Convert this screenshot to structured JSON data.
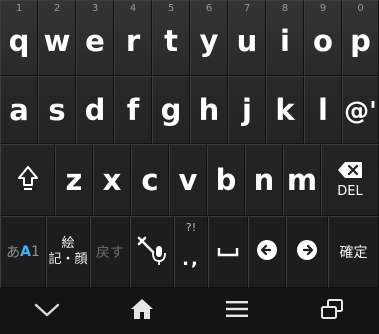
{
  "keyboard": {
    "row1": [
      {
        "letter": "q",
        "num": "1"
      },
      {
        "letter": "w",
        "num": "2"
      },
      {
        "letter": "e",
        "num": "3"
      },
      {
        "letter": "r",
        "num": "4"
      },
      {
        "letter": "t",
        "num": "5"
      },
      {
        "letter": "y",
        "num": "6"
      },
      {
        "letter": "u",
        "num": "7"
      },
      {
        "letter": "i",
        "num": "8"
      },
      {
        "letter": "o",
        "num": "9"
      },
      {
        "letter": "p",
        "num": "0"
      }
    ],
    "row2": [
      "a",
      "s",
      "d",
      "f",
      "g",
      "h",
      "j",
      "k",
      "l",
      "@'"
    ],
    "row3": [
      "z",
      "x",
      "c",
      "v",
      "b",
      "n",
      "m"
    ],
    "del_label": "DEL",
    "bottom": {
      "mode_kana": "あ",
      "mode_latin": "A",
      "mode_digit": "1",
      "emoji_line1": "絵",
      "emoji_line2": "記・顔",
      "undo_label": "戻す",
      "punct_top": "?!",
      "punct_bottom": ".,",
      "space_symbol": "␣",
      "enter_label": "確定"
    },
    "icons": {
      "shift": "shift-arrow-icon",
      "delete": "backspace-icon",
      "tools": "tool-mic-icon",
      "left": "arrow-left-icon",
      "right": "arrow-right-icon"
    }
  },
  "navbar": {
    "icons": [
      "chevron-down-icon",
      "home-icon",
      "menu-icon",
      "recent-apps-icon"
    ]
  }
}
